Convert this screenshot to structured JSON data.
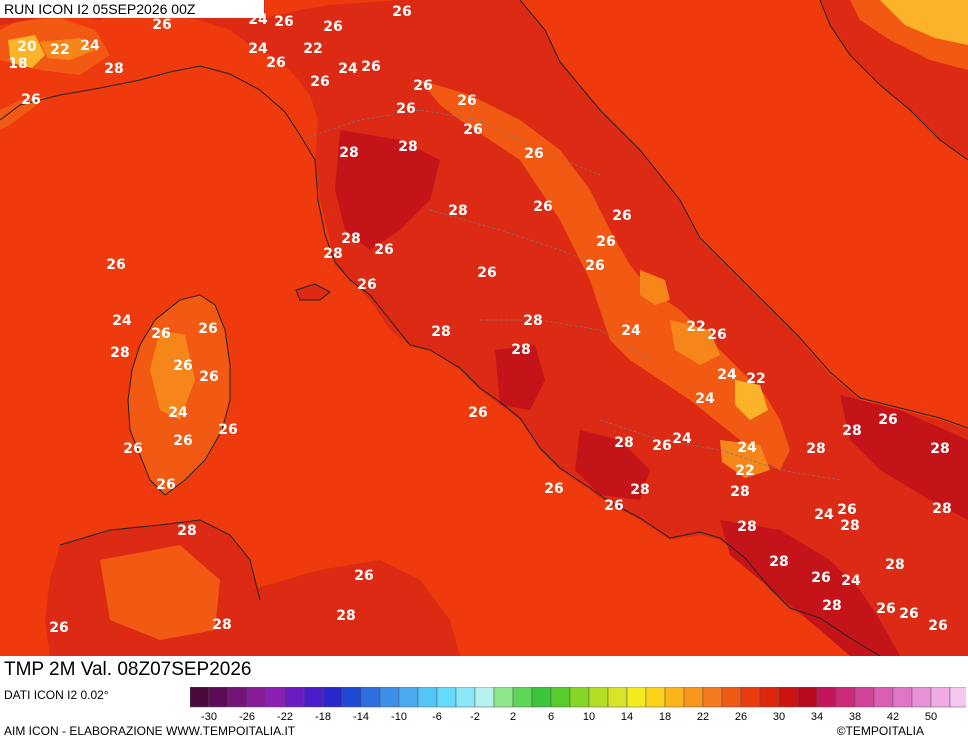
{
  "header": {
    "run_label": "RUN ICON I2 05SEP2026 00Z"
  },
  "footer": {
    "validity_label": "TMP 2M Val. 08Z07SEP2026",
    "data_note": "DATI ICON I2 0.02°",
    "credit_left": "AIM ICON - ELABORAZIONE WWW.TEMPOITALIA.IT",
    "credit_right": "©TEMPOITALIA"
  },
  "colors": {
    "sea_26": "#ee3a0c",
    "land_28": "#dc2a14",
    "land_30": "#c4141a",
    "hills_24": "#f25a14",
    "hills_22": "#f7861a",
    "mountain_20": "#fbb42a",
    "label": "#ffffff",
    "coastline": "#222222"
  },
  "legend": {
    "unit_hint": "°C",
    "tick_labels": [
      "-30",
      "-26",
      "-22",
      "-18",
      "-14",
      "-10",
      "-6",
      "-2",
      "2",
      "6",
      "10",
      "14",
      "18",
      "22",
      "26",
      "30",
      "34",
      "38",
      "42",
      "50"
    ],
    "swatches": [
      "#4a0a3c",
      "#5e0c5a",
      "#731479",
      "#861c98",
      "#8b1fb5",
      "#6a1bc4",
      "#4a1ccc",
      "#2a25cc",
      "#1e4ad6",
      "#2e6ee0",
      "#3c8ee8",
      "#4aaaf0",
      "#54c6f6",
      "#66dafa",
      "#8ce8f8",
      "#b8f2f0",
      "#8ee88a",
      "#5ed65a",
      "#3cc43c",
      "#56cc2c",
      "#86d628",
      "#b2de26",
      "#d8e426",
      "#f2ec1e",
      "#fcd21a",
      "#fcb41a",
      "#f8961c",
      "#f47a1c",
      "#f05a16",
      "#ea3c10",
      "#e0260c",
      "#cc1412",
      "#b80a1e",
      "#c4145a",
      "#cc2a7a",
      "#d2449a",
      "#da5eb4",
      "#e076c8",
      "#e890d8",
      "#f0aae4",
      "#f6c6ee"
    ]
  },
  "map": {
    "chart_data": {
      "type": "temperature-map",
      "variable": "TMP 2M",
      "contour_labels": [
        {
          "v": "26",
          "lon": 0
        },
        {
          "v": "24"
        },
        {
          "v": "26"
        },
        {
          "v": "26"
        },
        {
          "v": "20"
        },
        {
          "v": "22"
        },
        {
          "v": "24"
        },
        {
          "v": "28"
        },
        {
          "v": "18"
        },
        {
          "v": "26"
        },
        {
          "v": "24"
        },
        {
          "v": "26"
        },
        {
          "v": "22"
        },
        {
          "v": "26"
        },
        {
          "v": "24"
        },
        {
          "v": "26"
        },
        {
          "v": "26"
        },
        {
          "v": "26"
        },
        {
          "v": "26"
        },
        {
          "v": "26"
        },
        {
          "v": "28"
        },
        {
          "v": "28"
        },
        {
          "v": "26"
        },
        {
          "v": "26"
        },
        {
          "v": "28"
        },
        {
          "v": "26"
        },
        {
          "v": "26"
        },
        {
          "v": "28"
        },
        {
          "v": "26"
        },
        {
          "v": "28"
        },
        {
          "v": "26"
        },
        {
          "v": "26"
        },
        {
          "v": "26"
        },
        {
          "v": "26"
        },
        {
          "v": "24"
        },
        {
          "v": "26"
        },
        {
          "v": "26"
        },
        {
          "v": "28"
        },
        {
          "v": "28"
        },
        {
          "v": "28"
        },
        {
          "v": "26"
        },
        {
          "v": "28"
        },
        {
          "v": "24"
        },
        {
          "v": "22"
        },
        {
          "v": "26"
        },
        {
          "v": "24"
        },
        {
          "v": "22"
        },
        {
          "v": "26"
        },
        {
          "v": "26"
        },
        {
          "v": "24"
        },
        {
          "v": "24"
        },
        {
          "v": "26"
        },
        {
          "v": "26"
        },
        {
          "v": "26"
        },
        {
          "v": "26"
        },
        {
          "v": "28"
        },
        {
          "v": "26"
        },
        {
          "v": "24"
        },
        {
          "v": "28"
        },
        {
          "v": "24"
        },
        {
          "v": "22"
        },
        {
          "v": "28"
        },
        {
          "v": "26"
        },
        {
          "v": "28"
        },
        {
          "v": "26"
        },
        {
          "v": "28"
        },
        {
          "v": "26"
        },
        {
          "v": "28"
        },
        {
          "v": "26"
        },
        {
          "v": "24"
        },
        {
          "v": "26"
        },
        {
          "v": "28"
        },
        {
          "v": "28"
        },
        {
          "v": "28"
        },
        {
          "v": "28"
        },
        {
          "v": "28"
        },
        {
          "v": "26"
        },
        {
          "v": "24"
        },
        {
          "v": "28"
        },
        {
          "v": "26"
        },
        {
          "v": "28"
        },
        {
          "v": "28"
        },
        {
          "v": "26"
        },
        {
          "v": "26"
        },
        {
          "v": "26"
        },
        {
          "v": "28"
        },
        {
          "v": "26"
        },
        {
          "v": "28"
        },
        {
          "v": "28"
        },
        {
          "v": "24"
        },
        {
          "v": "22"
        },
        {
          "v": "28"
        },
        {
          "v": "26"
        },
        {
          "v": "28"
        },
        {
          "v": "26"
        },
        {
          "v": "26"
        },
        {
          "v": "28"
        },
        {
          "v": "28"
        },
        {
          "v": "28"
        }
      ]
    }
  }
}
